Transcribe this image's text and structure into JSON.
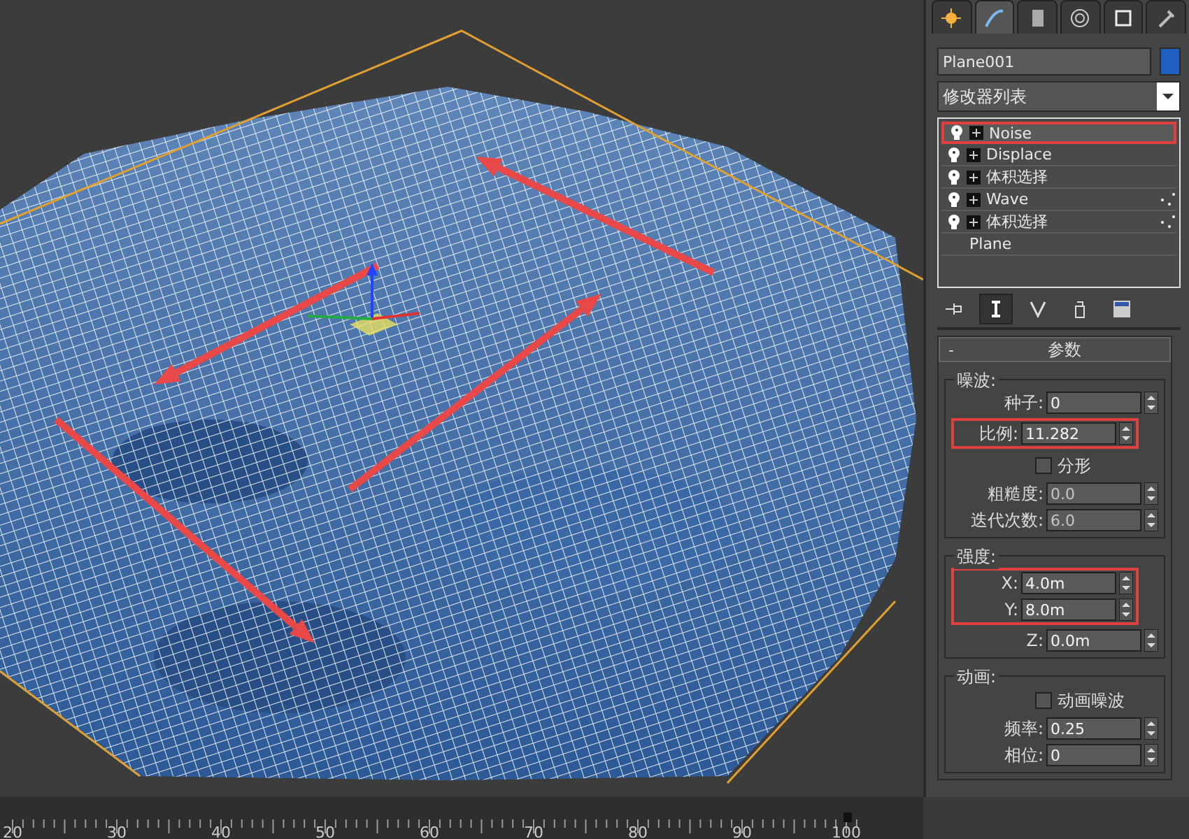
{
  "command_tabs": [
    {
      "selected": false
    },
    {
      "selected": true
    },
    {
      "selected": false
    },
    {
      "selected": false
    },
    {
      "selected": false
    },
    {
      "selected": false
    }
  ],
  "object_name": {
    "value": "Plane001"
  },
  "modifier_list": {
    "label": "修改器列表"
  },
  "modifier_stack": [
    {
      "name": "Noise",
      "kind": "plain",
      "selected": true,
      "highlighted": true
    },
    {
      "name": "Displace",
      "kind": "plain",
      "selected": false,
      "highlighted": false
    },
    {
      "name": "体积选择",
      "kind": "plain",
      "selected": false,
      "highlighted": false
    },
    {
      "name": "Wave",
      "kind": "sub",
      "selected": false,
      "highlighted": false
    },
    {
      "name": "体积选择",
      "kind": "sub",
      "selected": false,
      "highlighted": false
    },
    {
      "name": "Plane",
      "kind": "base",
      "selected": false,
      "highlighted": false
    }
  ],
  "stack_tools": [
    {
      "selected": false
    },
    {
      "selected": true
    },
    {
      "selected": false
    },
    {
      "selected": false
    },
    {
      "selected": false
    }
  ],
  "rollout": {
    "collapse": "-",
    "title": "参数",
    "groups": [
      {
        "title": "噪波:",
        "items": [
          {
            "kind": "field",
            "label": "种子:",
            "value": "0",
            "disabled": false,
            "highlighted": false
          },
          {
            "kind": "field",
            "label": "比例:",
            "value": "11.282",
            "disabled": false,
            "highlighted": true
          },
          {
            "kind": "checkbox",
            "label": "分形",
            "checked": false
          },
          {
            "kind": "field",
            "label": "粗糙度:",
            "value": "0.0",
            "disabled": true,
            "highlighted": false
          },
          {
            "kind": "field",
            "label": "迭代次数:",
            "value": "6.0",
            "disabled": true,
            "highlighted": false
          }
        ]
      },
      {
        "title": "强度:",
        "items": [
          {
            "kind": "field",
            "label": "X:",
            "value": "4.0m",
            "disabled": false,
            "highlighted": true
          },
          {
            "kind": "field",
            "label": "Y:",
            "value": "8.0m",
            "disabled": false,
            "highlighted": true
          },
          {
            "kind": "field",
            "label": "Z:",
            "value": "0.0m",
            "disabled": false,
            "highlighted": false
          }
        ]
      },
      {
        "title": "动画:",
        "items": [
          {
            "kind": "checkbox",
            "label": "动画噪波",
            "checked": false
          },
          {
            "kind": "field",
            "label": "频率:",
            "value": "0.25",
            "disabled": false,
            "highlighted": false
          },
          {
            "kind": "field",
            "label": "相位:",
            "value": "0",
            "disabled": false,
            "highlighted": false
          }
        ]
      }
    ]
  },
  "timeline": {
    "labels": [
      "20",
      "30",
      "40",
      "50",
      "60",
      "70",
      "80",
      "90",
      "100"
    ]
  }
}
